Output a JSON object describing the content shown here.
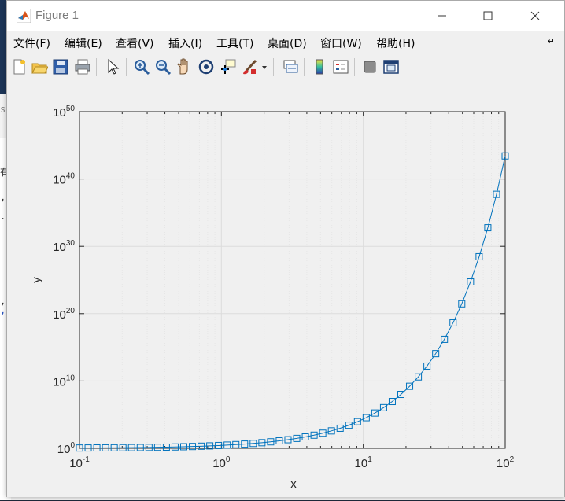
{
  "window": {
    "title": "Figure 1"
  },
  "menu": [
    "文件(F)",
    "编辑(E)",
    "查看(V)",
    "插入(I)",
    "工具(T)",
    "桌面(D)",
    "窗口(W)",
    "帮助(H)"
  ],
  "toolbar_icons": [
    "new-figure-icon",
    "open-file-icon",
    "save-icon",
    "print-icon",
    "pointer-icon",
    "zoom-in-icon",
    "zoom-out-icon",
    "pan-hand-icon",
    "rotate-3d-icon",
    "data-cursor-icon",
    "brush-icon",
    "link-plot-icon",
    "colorbar-icon",
    "legend-icon",
    "hide-plot-tools-icon",
    "show-plot-tools-icon"
  ],
  "chart_data": {
    "type": "line",
    "xlabel": "x",
    "ylabel": "y",
    "xscale": "log",
    "yscale": "log",
    "xlim": [
      0.1,
      100
    ],
    "ylim": [
      1,
      1e+50
    ],
    "x_ticks": [
      "10^-1",
      "10^0",
      "10^1",
      "10^2"
    ],
    "y_ticks": [
      "10^0",
      "10^10",
      "10^20",
      "10^30",
      "10^40",
      "10^50"
    ],
    "grid": true,
    "series": [
      {
        "marker": "square",
        "color": "#0072bd",
        "function": "y = exp(x)",
        "x_range": [
          0.1,
          100
        ],
        "num_points": 50
      }
    ]
  },
  "background": {
    "glyphs": [
      ",",
      ".x",
      ",",
      ","
    ],
    "strip_label": "有",
    "small_label": "s"
  }
}
